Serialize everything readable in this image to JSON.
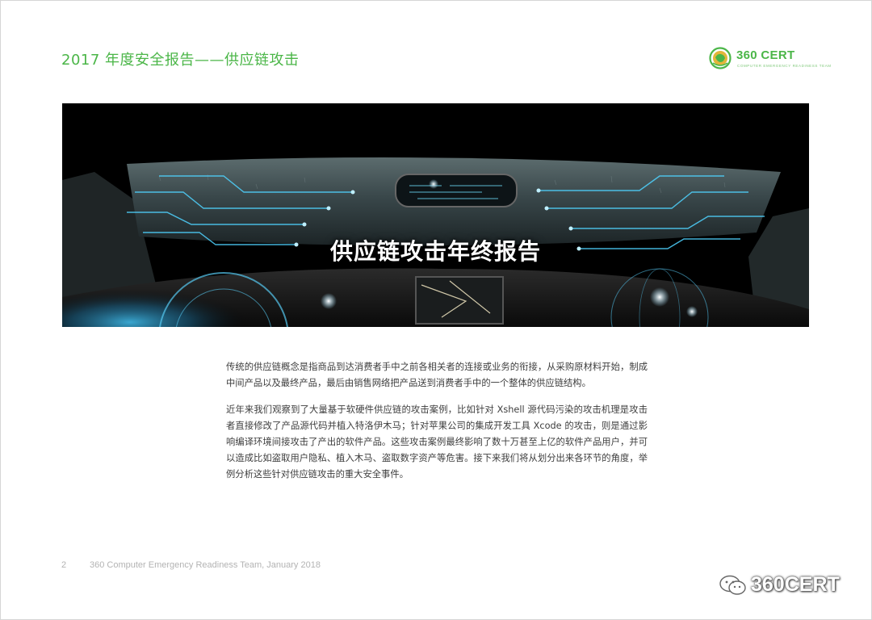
{
  "header": {
    "title": "2017 年度安全报告——供应链攻击"
  },
  "logo": {
    "name": "360 CERT",
    "subtitle": "COMPUTER EMERGENCY READINESS TEAM",
    "icon": "360-globe-logo-icon"
  },
  "hero": {
    "title": "供应链攻击年终报告",
    "image": "car-dashboard-circuit-illustration"
  },
  "body": {
    "paragraph1": "传统的供应链概念是指商品到达消费者手中之前各相关者的连接或业务的衔接，从采购原材料开始，制成中间产品以及最终产品，最后由销售网络把产品送到消费者手中的一个整体的供应链结构。",
    "paragraph2": "近年来我们观察到了大量基于软硬件供应链的攻击案例，比如针对 Xshell 源代码污染的攻击机理是攻击者直接修改了产品源代码并植入特洛伊木马；针对苹果公司的集成开发工具 Xcode 的攻击，则是通过影响编译环境间接攻击了产出的软件产品。这些攻击案例最终影响了数十万甚至上亿的软件产品用户，并可以造成比如盗取用户隐私、植入木马、盗取数字资产等危害。接下来我们将从划分出来各环节的角度，举例分析这些针对供应链攻击的重大安全事件。"
  },
  "footer": {
    "page_number": "2",
    "text": "360 Computer Emergency Readiness Team, January 2018"
  },
  "watermark": {
    "text": "360CERT",
    "icon": "wechat-icon"
  },
  "colors": {
    "accent": "#4bb648",
    "body_text": "#3d3d3d",
    "footer_text": "#b3b3b3"
  }
}
